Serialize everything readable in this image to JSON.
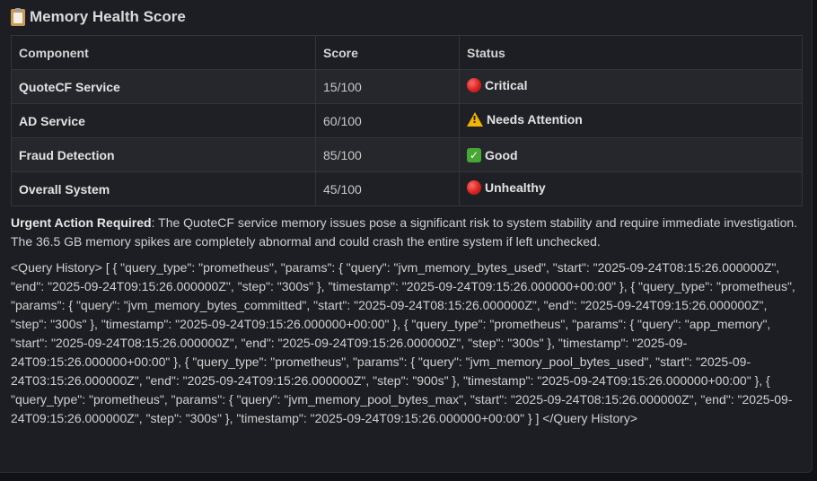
{
  "heading": {
    "icon": "clipboard-icon",
    "title": "Memory Health Score"
  },
  "table": {
    "headers": [
      "Component",
      "Score",
      "Status"
    ],
    "rows": [
      {
        "component": "QuoteCF Service",
        "score": "15/100",
        "status_icon": "red-circle-icon",
        "status": "Critical"
      },
      {
        "component": "AD Service",
        "score": "60/100",
        "status_icon": "warning-icon",
        "status": "Needs Attention"
      },
      {
        "component": "Fraud Detection",
        "score": "85/100",
        "status_icon": "check-icon",
        "status": "Good"
      },
      {
        "component": "Overall System",
        "score": "45/100",
        "status_icon": "red-circle-icon",
        "status": "Unhealthy"
      }
    ]
  },
  "urgent": {
    "label": "Urgent Action Required",
    "text": ": The QuoteCF service memory issues pose a significant risk to system stability and require immediate investigation. The 36.5 GB memory spikes are completely abnormal and could crash the entire system if left unchecked."
  },
  "query_history": "<Query History> [ { \"query_type\": \"prometheus\", \"params\": { \"query\": \"jvm_memory_bytes_used\", \"start\": \"2025-09-24T08:15:26.000000Z\", \"end\": \"2025-09-24T09:15:26.000000Z\", \"step\": \"300s\" }, \"timestamp\": \"2025-09-24T09:15:26.000000+00:00\" }, { \"query_type\": \"prometheus\", \"params\": { \"query\": \"jvm_memory_bytes_committed\", \"start\": \"2025-09-24T08:15:26.000000Z\", \"end\": \"2025-09-24T09:15:26.000000Z\", \"step\": \"300s\" }, \"timestamp\": \"2025-09-24T09:15:26.000000+00:00\" }, { \"query_type\": \"prometheus\", \"params\": { \"query\": \"app_memory\", \"start\": \"2025-09-24T08:15:26.000000Z\", \"end\": \"2025-09-24T09:15:26.000000Z\", \"step\": \"300s\" }, \"timestamp\": \"2025-09-24T09:15:26.000000+00:00\" }, { \"query_type\": \"prometheus\", \"params\": { \"query\": \"jvm_memory_pool_bytes_used\", \"start\": \"2025-09-24T03:15:26.000000Z\", \"end\": \"2025-09-24T09:15:26.000000Z\", \"step\": \"900s\" }, \"timestamp\": \"2025-09-24T09:15:26.000000+00:00\" }, { \"query_type\": \"prometheus\", \"params\": { \"query\": \"jvm_memory_pool_bytes_max\", \"start\": \"2025-09-24T08:15:26.000000Z\", \"end\": \"2025-09-24T09:15:26.000000Z\", \"step\": \"300s\" }, \"timestamp\": \"2025-09-24T09:15:26.000000+00:00\" } ] </Query History>"
}
